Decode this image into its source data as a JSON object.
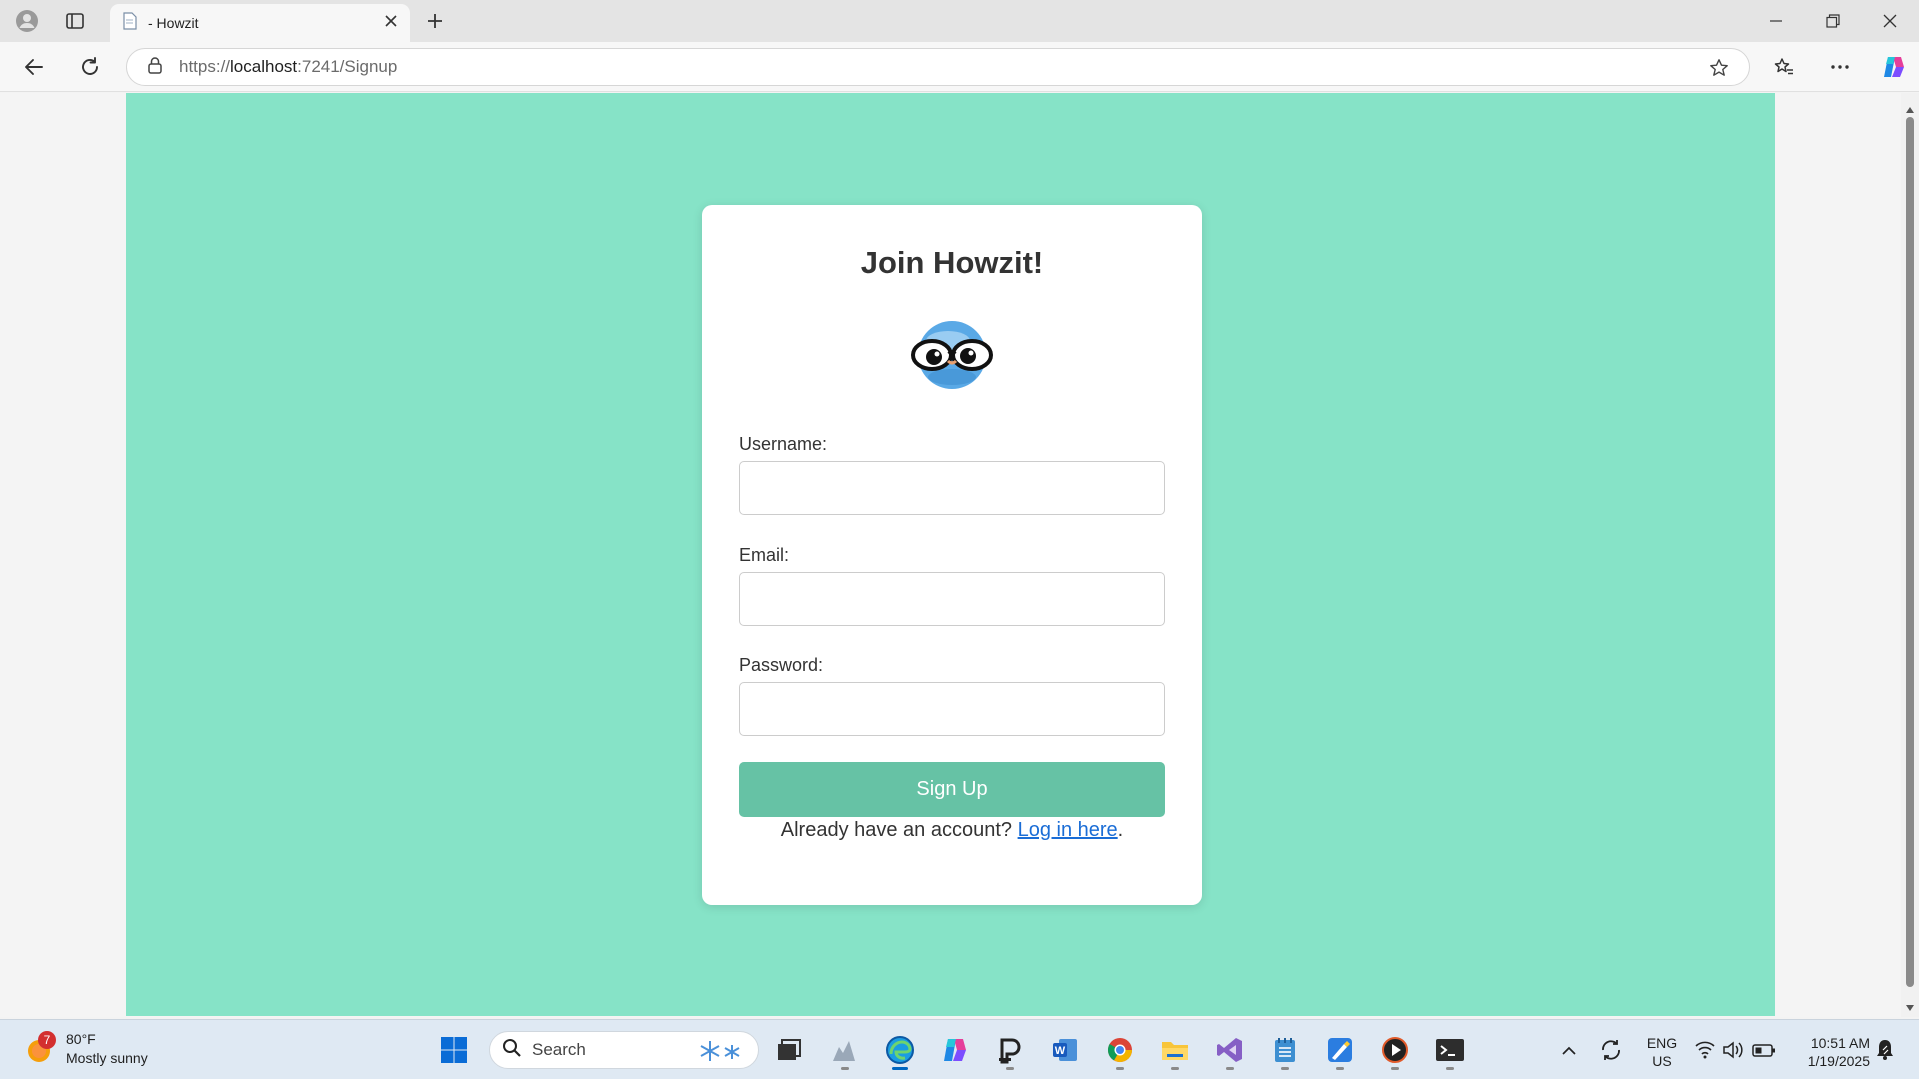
{
  "browser": {
    "tab_title": "- Howzit",
    "url_prefix": "https://",
    "url_host": "localhost",
    "url_rest": ":7241/Signup"
  },
  "signup": {
    "title": "Join Howzit!",
    "username_label": "Username:",
    "username_value": "",
    "email_label": "Email:",
    "email_value": "",
    "password_label": "Password:",
    "password_value": "",
    "submit_label": "Sign Up",
    "login_prompt": "Already have an account?",
    "login_link": "Log in here",
    "login_suffix": "."
  },
  "taskbar": {
    "weather_badge": "7",
    "weather_temp": "80°F",
    "weather_desc": "Mostly sunny",
    "search_placeholder": "Search",
    "lang_line1": "ENG",
    "lang_line2": "US",
    "time": "10:51 AM",
    "date": "1/19/2025"
  },
  "colors": {
    "page_bg": "#86e3c7",
    "button_bg": "#66c2a5",
    "link": "#1a6dd6",
    "accent": "#0067c0"
  }
}
